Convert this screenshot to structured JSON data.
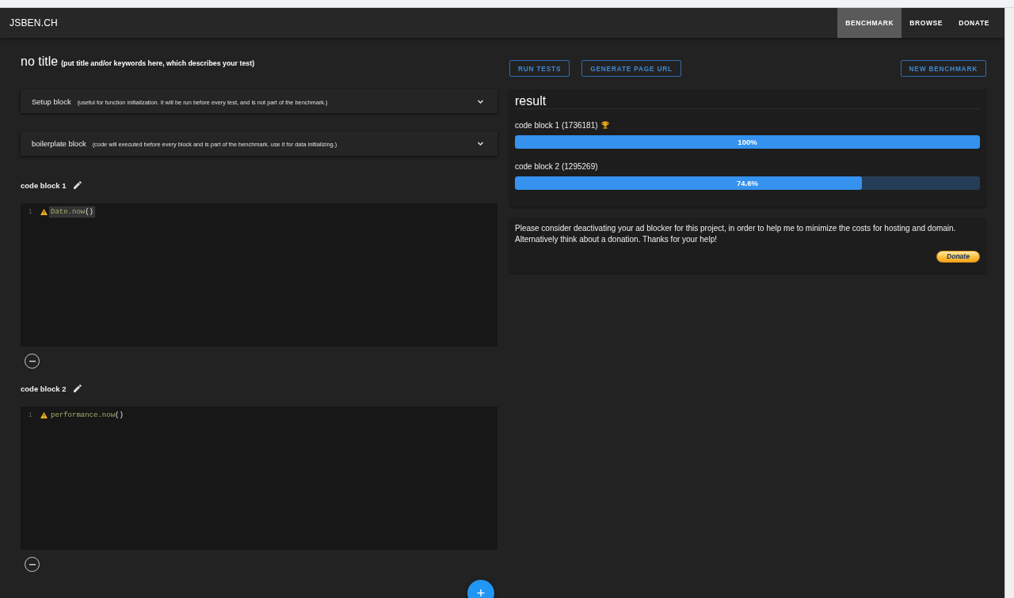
{
  "header": {
    "logo": "JSBEN.CH",
    "nav": [
      {
        "label": "BENCHMARK",
        "selected": true
      },
      {
        "label": "BROWSE",
        "selected": false
      },
      {
        "label": "DONATE",
        "selected": false
      }
    ]
  },
  "title": {
    "text": "no title",
    "hint": "(put title and/or keywords here, which describes your test)"
  },
  "panels": [
    {
      "title": "Setup block",
      "hint": "(useful for function initialization. it will be run before every test, and is not part of the benchmark.)",
      "expanded": false
    },
    {
      "title": "boilerplate block",
      "hint": "(code will executed before every block and is part of the benchmark. use it for data initializing.)",
      "expanded": false
    }
  ],
  "code_blocks": [
    {
      "name": "code block 1",
      "lines": [
        {
          "number": "1",
          "warning": true,
          "highlighted": true,
          "tokens": [
            {
              "kind": "identifier",
              "text": "Date"
            },
            {
              "kind": "dot",
              "text": "."
            },
            {
              "kind": "identifier",
              "text": "now"
            },
            {
              "kind": "paren",
              "text": "()"
            }
          ]
        }
      ]
    },
    {
      "name": "code block 2",
      "lines": [
        {
          "number": "1",
          "warning": true,
          "highlighted": false,
          "tokens": [
            {
              "kind": "identifier",
              "text": "performance"
            },
            {
              "kind": "dot",
              "text": "."
            },
            {
              "kind": "identifier",
              "text": "now"
            },
            {
              "kind": "paren",
              "text": "()"
            }
          ]
        }
      ]
    }
  ],
  "add_button": {
    "label": "+"
  },
  "actions": {
    "left": [
      "RUN TESTS",
      "GENERATE PAGE URL"
    ],
    "right": [
      "NEW BENCHMARK"
    ]
  },
  "result": {
    "title": "result",
    "rows": [
      {
        "label": "code block 1 (1736181)",
        "winner": true,
        "level": 1,
        "reading": "100%"
      },
      {
        "label": "code block 2 (1295269)",
        "winner": false,
        "level": 0.746,
        "reading": "74.6%"
      }
    ]
  },
  "notice": {
    "text": "Please consider deactivating your ad blocker for this project, in order to help me to minimize the costs for hosting and domain. Alternatively think about a donation. Thanks for your help!",
    "button": "Donate"
  }
}
